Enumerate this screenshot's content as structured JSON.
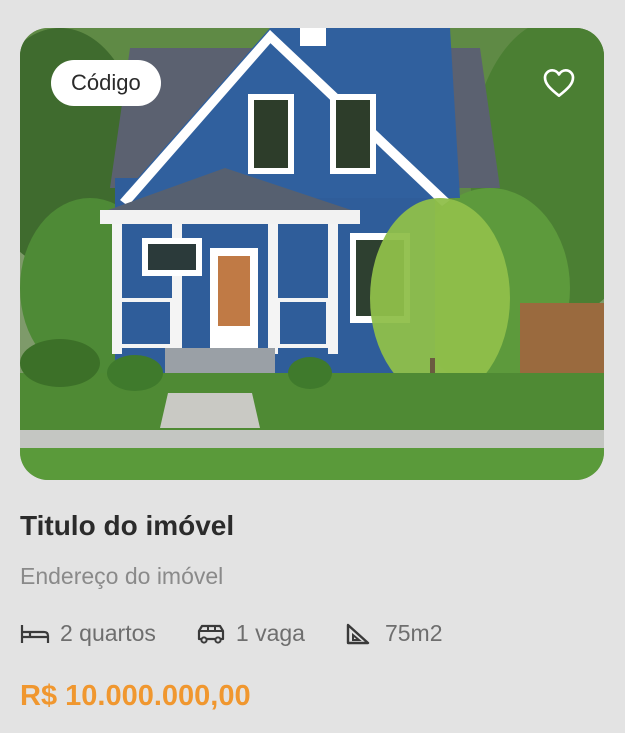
{
  "listing": {
    "code_label": "Código",
    "favorite_icon": "heart-outline-icon",
    "title": "Titulo do imóvel",
    "address": "Endereço do imóvel",
    "features": {
      "bedrooms": {
        "icon": "bed-icon",
        "label": "2 quartos"
      },
      "parking": {
        "icon": "car-icon",
        "label": "1 vaga"
      },
      "area": {
        "icon": "set-square-icon",
        "label": "75m2"
      }
    },
    "price": "R$ 10.000.000,00"
  },
  "colors": {
    "background": "#e3e3e3",
    "price": "#f0972f",
    "title": "#2b2b2b",
    "secondary_text": "#8a8a8a"
  }
}
